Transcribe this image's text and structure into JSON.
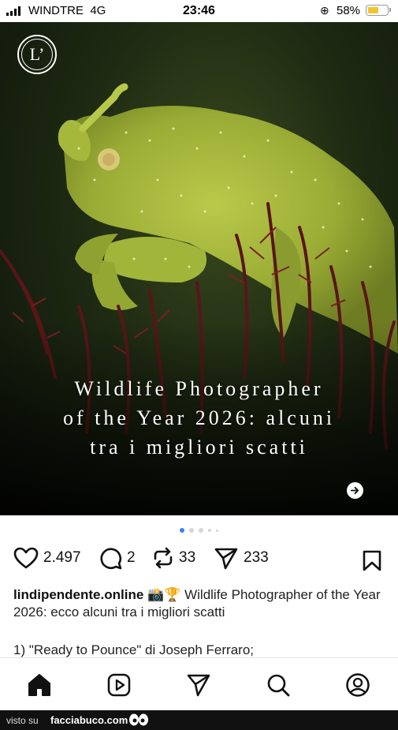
{
  "status_bar": {
    "carrier": "WINDTRE",
    "network": "4G",
    "time": "23:46",
    "battery_percent": "58%",
    "battery_level": 0.58,
    "battery_color": "#f4c430"
  },
  "post": {
    "logo_text": "L’",
    "headline": "Wildlife Photographer of the Year 2026: alcuni tra i migliori scatti",
    "headline_lines": [
      "Wildlife Photographer",
      "of the Year 2026: alcuni",
      "tra i migliori scatti"
    ],
    "next_icon": "arrow-right-circle-icon",
    "carousel": {
      "total": 5,
      "active": 1,
      "active_color": "#3b82f6"
    },
    "likes": "2.497",
    "comments": "2",
    "reposts": "33",
    "shares": "233",
    "caption_user": "lindipendente.online",
    "caption_emoji": "📸🏆",
    "caption_text": "Wildlife Photographer of the Year 2026: ecco alcuni tra i migliori scatti",
    "caption_line2": "1) \"Ready to Pounce\" di Joseph Ferraro;"
  },
  "bottom_nav": {
    "items": [
      "home-icon",
      "reels-icon",
      "messages-icon",
      "search-icon",
      "profile-icon"
    ]
  },
  "footer": {
    "visto_su": "visto su",
    "brand": "facciabuco.com"
  }
}
